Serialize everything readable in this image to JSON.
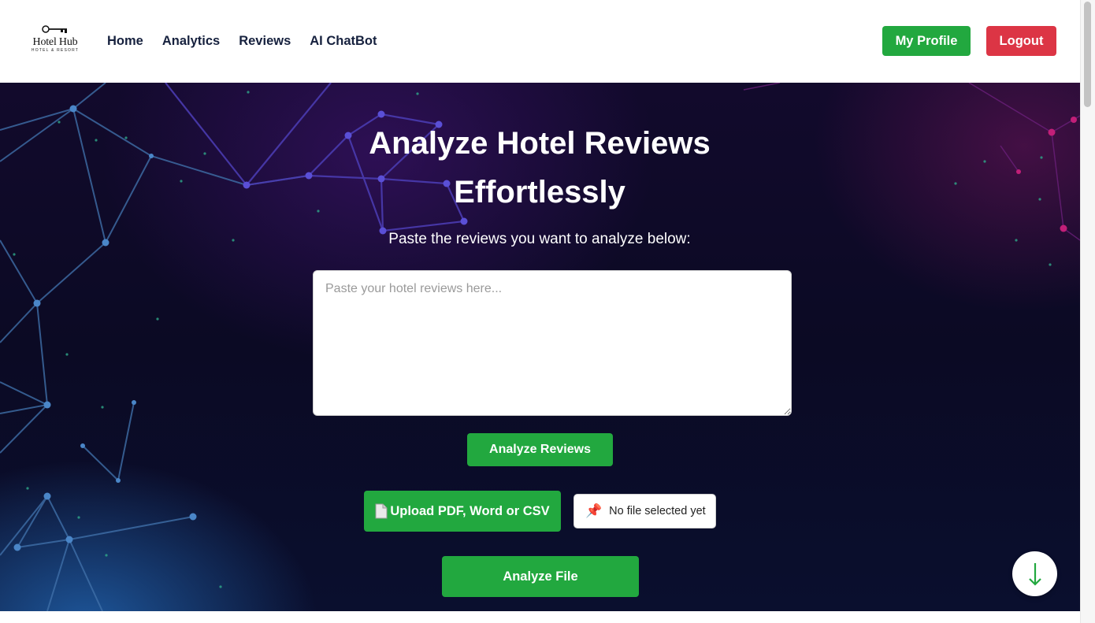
{
  "logo": {
    "name": "Hotel Hub",
    "tagline": "HOTEL & RESORT",
    "icon": "key-icon"
  },
  "nav": {
    "items": [
      "Home",
      "Analytics",
      "Reviews",
      "AI ChatBot"
    ]
  },
  "header_buttons": {
    "profile": "My Profile",
    "logout": "Logout"
  },
  "hero": {
    "title_line1": "Analyze Hotel Reviews",
    "title_line2": "Effortlessly",
    "subtitle": "Paste the reviews you want to analyze below:",
    "review_placeholder": "Paste your hotel reviews here...",
    "review_value": "",
    "analyze_button": "Analyze Reviews",
    "upload_button": "Upload PDF, Word or CSV",
    "upload_icon": "document-icon",
    "file_status_icon": "📌",
    "file_status": "No file selected yet",
    "analyze_file_button": "Analyze File",
    "scroll_down_icon": "arrow-down-icon"
  },
  "colors": {
    "primary_green": "#22a83f",
    "danger_red": "#dc3545",
    "nav_text": "#16213e",
    "hero_dark": "#0b0a24"
  }
}
